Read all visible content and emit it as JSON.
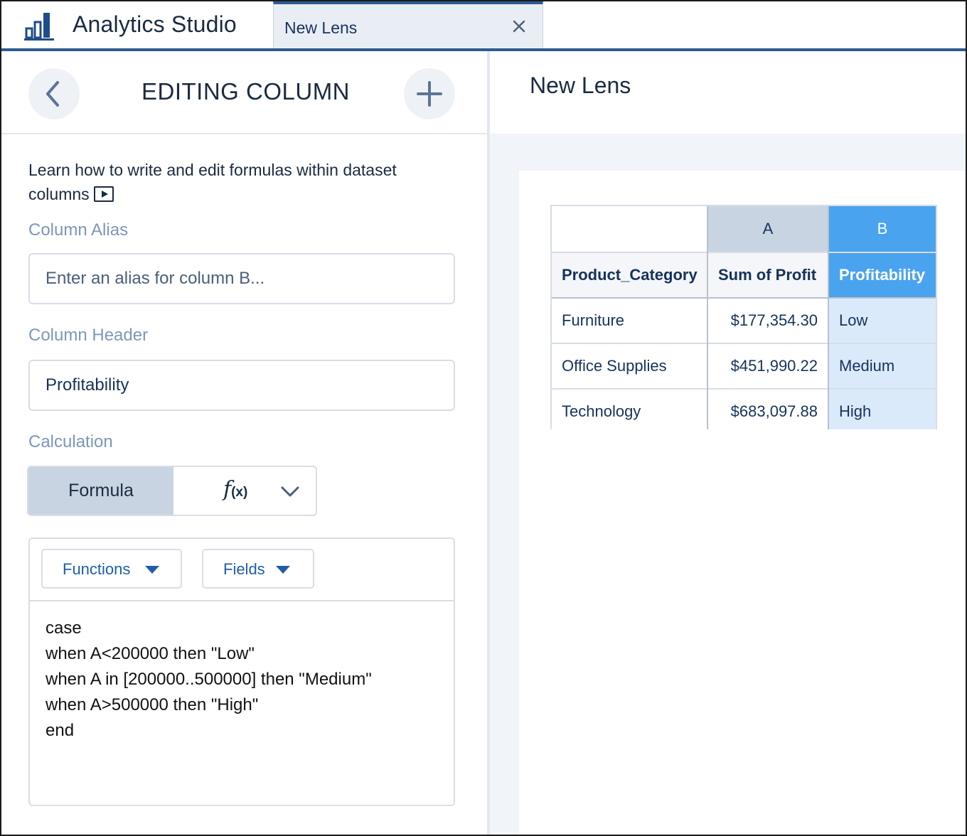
{
  "app": {
    "title": "Analytics Studio",
    "logo_icon": "bar-chart-icon"
  },
  "tabs": [
    {
      "label": "New Lens",
      "active": true,
      "close_icon": "close-icon"
    }
  ],
  "editor_panel": {
    "back_icon": "chevron-left-icon",
    "title": "EDITING COLUMN",
    "add_icon": "plus-icon",
    "help_text": "Learn how to write and edit formulas within dataset columns",
    "help_icon": "video-play-icon",
    "column_alias": {
      "label": "Column Alias",
      "value": "",
      "placeholder": "Enter an alias for column B..."
    },
    "column_header": {
      "label": "Column Header",
      "value": "Profitability"
    },
    "calculation": {
      "label": "Calculation",
      "selected": "Formula",
      "fx_label": "f",
      "fx_sub": "(x)"
    },
    "formula_toolbar": {
      "functions_label": "Functions",
      "fields_label": "Fields"
    },
    "formula": "case\nwhen A<200000 then \"Low\"\nwhen A in [200000..500000] then \"Medium\"\nwhen A>500000 then \"High\"\nend"
  },
  "lens": {
    "title": "New Lens",
    "table": {
      "column_letters": [
        "",
        "A",
        "B"
      ],
      "headers": [
        "Product_Category",
        "Sum of Profit",
        "Profitability"
      ],
      "rows": [
        [
          "Furniture",
          "$177,354.30",
          "Low"
        ],
        [
          "Office Supplies",
          "$451,990.22",
          "Medium"
        ],
        [
          "Technology",
          "$683,097.88",
          "High"
        ]
      ]
    }
  },
  "colors": {
    "brand_blue": "#2e5b92",
    "selected_column": "#4aa3ee",
    "selected_column_cells": "#dbeafb",
    "link_blue": "#1f5da8"
  }
}
